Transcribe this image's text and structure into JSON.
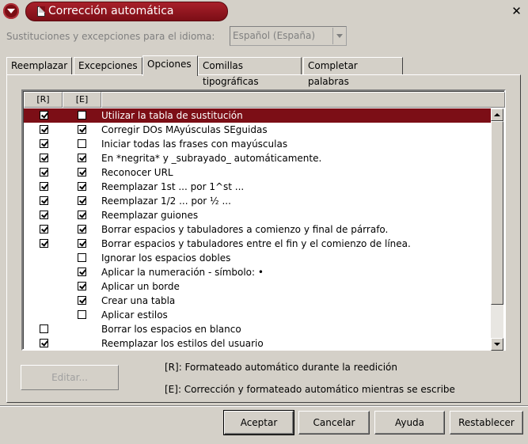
{
  "window": {
    "title": "Corrección automática",
    "close_glyph": "✕"
  },
  "language": {
    "label": "Sustituciones y excepciones para el idioma:",
    "value": "Español (España)"
  },
  "tabs": [
    {
      "label": "Reemplazar",
      "active": false
    },
    {
      "label": "Excepciones",
      "active": false
    },
    {
      "label": "Opciones",
      "active": true
    },
    {
      "label": "Comillas tipográficas",
      "active": false
    },
    {
      "label": "Completar palabras",
      "active": false
    }
  ],
  "list": {
    "col_r": "[R]",
    "col_e": "[E]",
    "rows": [
      {
        "label": "Utilizar la tabla de sustitución",
        "r": true,
        "e": false,
        "selected": true
      },
      {
        "label": "Corregir DOs MAyúsculas SEguidas",
        "r": true,
        "e": true
      },
      {
        "label": "Iniciar todas las frases con mayúsculas",
        "r": true,
        "e": false
      },
      {
        "label": "En *negrita* y _subrayado_ automáticamente.",
        "r": true,
        "e": true
      },
      {
        "label": "Reconocer URL",
        "r": true,
        "e": true
      },
      {
        "label": "Reemplazar 1st ... por 1^st ...",
        "r": true,
        "e": true
      },
      {
        "label": "Reemplazar 1/2 ... por ½ ...",
        "r": true,
        "e": true
      },
      {
        "label": "Reemplazar guiones",
        "r": true,
        "e": true
      },
      {
        "label": "Borrar espacios y tabuladores a comienzo y final de párrafo.",
        "r": true,
        "e": true
      },
      {
        "label": "Borrar espacios y tabuladores entre el fin y el comienzo de línea.",
        "r": true,
        "e": true
      },
      {
        "label": "Ignorar los espacios dobles",
        "r": null,
        "e": false
      },
      {
        "label": "Aplicar la numeración - símbolo: •",
        "r": null,
        "e": true
      },
      {
        "label": "Aplicar un borde",
        "r": null,
        "e": true
      },
      {
        "label": "Crear una tabla",
        "r": null,
        "e": true
      },
      {
        "label": "Aplicar estilos",
        "r": null,
        "e": false
      },
      {
        "label": "Borrar los espacios en blanco",
        "r": false,
        "e": null
      },
      {
        "label": "Reemplazar los estilos del usuario",
        "r": true,
        "e": null
      }
    ]
  },
  "edit_button": "Editar...",
  "legend": {
    "r": "[R]: Formateado automático durante la reedición",
    "e": "[E]: Corrección y formateado automático mientras se escribe"
  },
  "buttons": {
    "accept": "Aceptar",
    "cancel": "Cancelar",
    "help": "Ayuda",
    "reset": "Restablecer"
  }
}
